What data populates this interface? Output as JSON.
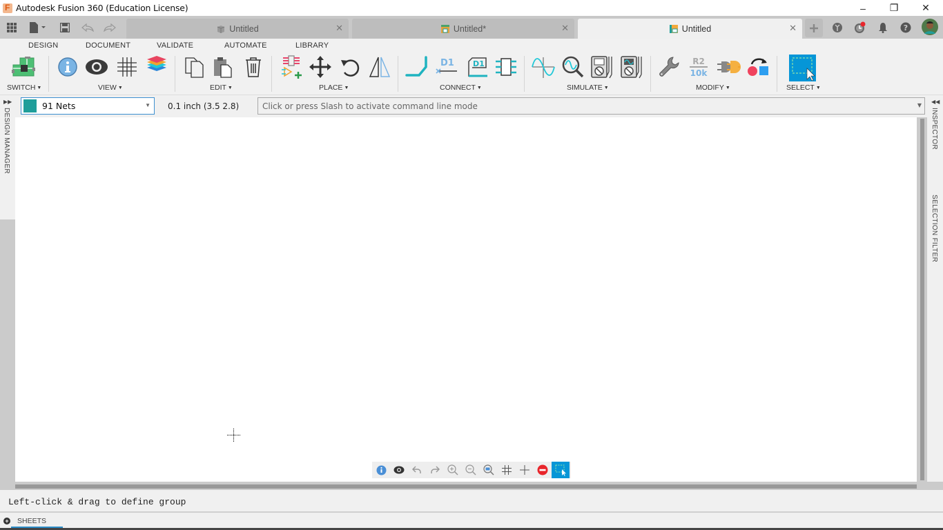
{
  "window": {
    "title": "Autodesk Fusion 360 (Education License)",
    "controls": {
      "minimize": "–",
      "restore": "❐",
      "close": "✕"
    }
  },
  "quick_access": {
    "items": [
      "apps-grid-icon",
      "file-menu-icon",
      "save-icon",
      "undo-icon",
      "redo-icon"
    ]
  },
  "tabs": [
    {
      "label": "Untitled",
      "icon": "3d-design-icon",
      "active": false
    },
    {
      "label": "Untitled*",
      "icon": "schematic-board-icon",
      "active": false
    },
    {
      "label": "Untitled",
      "icon": "schematic-icon",
      "active": true
    }
  ],
  "tab_bar_right": {
    "items": [
      "new-tab-icon",
      "extensions-icon",
      "job-status-icon",
      "notifications-icon",
      "help-icon",
      "user-avatar"
    ],
    "job_status_dot_color": "#e8252b"
  },
  "toolbar": {
    "menu_tabs": [
      "DESIGN",
      "DOCUMENT",
      "VALIDATE",
      "AUTOMATE",
      "LIBRARY"
    ],
    "groups": [
      {
        "label": "SWITCH",
        "tools": [
          "switch-to-pcb-icon"
        ]
      },
      {
        "label": "VIEW",
        "tools": [
          "info-icon",
          "show-icon",
          "grid-icon",
          "layers-icon"
        ]
      },
      {
        "label": "EDIT",
        "tools": [
          "copy-icon",
          "paste-icon",
          "delete-icon"
        ]
      },
      {
        "label": "PLACE",
        "tools": [
          "place-component-icon",
          "move-icon",
          "rotate-icon",
          "mirror-icon"
        ]
      },
      {
        "label": "CONNECT",
        "tools": [
          "net-icon",
          "net-label-icon",
          "net-xref-icon",
          "pin-icon"
        ]
      },
      {
        "label": "SIMULATE",
        "tools": [
          "sim-signal-icon",
          "sim-probe-icon",
          "multimeter-icon",
          "oscilloscope-icon"
        ]
      },
      {
        "label": "MODIFY",
        "tools": [
          "wrench-icon",
          "value-icon",
          "gate-swap-icon",
          "replace-icon"
        ]
      },
      {
        "label": "SELECT",
        "tools": [
          "window-select-icon"
        ]
      }
    ],
    "value_icon_text": {
      "name": "R2",
      "value": "10k"
    },
    "net_label_text": "D1",
    "accent": "#0696d7"
  },
  "command_row": {
    "net_class": {
      "label": "91 Nets",
      "color": "#1f9e9a"
    },
    "grid_readout": "0.1 inch (3.5 2.8)",
    "command_placeholder": "Click or press Slash to activate command line mode"
  },
  "side_panels": {
    "left": "DESIGN MANAGER",
    "right_top": "INSPECTOR",
    "right_bottom": "SELECTION FILTER"
  },
  "nav_bar": {
    "items": [
      "info-icon",
      "show-icon",
      "undo-icon",
      "redo-icon",
      "zoom-in-icon",
      "zoom-out-icon",
      "zoom-fit-icon",
      "grid-icon",
      "crosshair-icon",
      "stop-icon",
      "window-select-icon"
    ]
  },
  "status": {
    "message": "Left-click & drag to define group"
  },
  "sheets": {
    "label": "SHEETS"
  }
}
